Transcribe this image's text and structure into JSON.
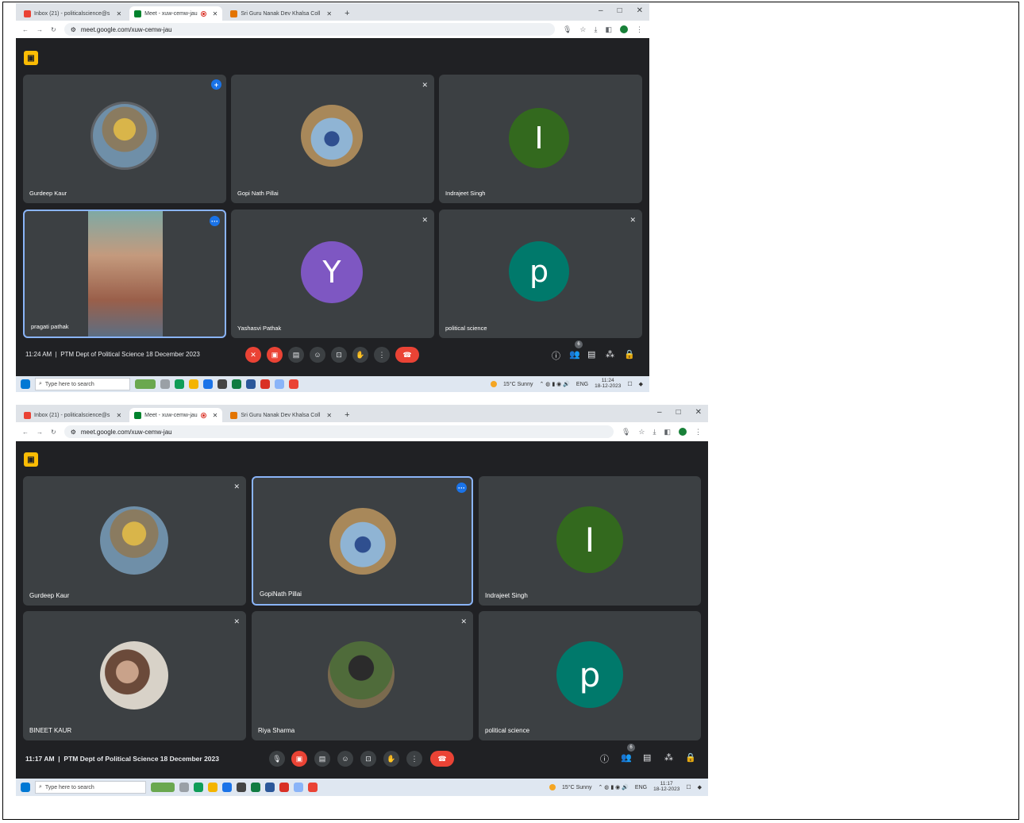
{
  "screens": [
    {
      "tabs": [
        {
          "label": "Inbox (21) - politicalscience@s",
          "favicon_color": "#ea4335"
        },
        {
          "label": "Meet - xuw-cemw-jau",
          "favicon_color": "#00832d"
        },
        {
          "label": "Sri Guru Nanak Dev Khalsa Coll",
          "favicon_color": "#e37400"
        }
      ],
      "url": "meet.google.com/xuw-cemw-jau",
      "participants": [
        {
          "name": "Gurdeep Kaur",
          "type": "photo",
          "badge": "+"
        },
        {
          "name": "Gopi Nath Pillai",
          "type": "photo",
          "muted": true
        },
        {
          "name": "Indrajeet Singh",
          "type": "initial",
          "initial": "I",
          "color": "#33691e"
        },
        {
          "name": "pragati pathak",
          "type": "video",
          "badge": "···"
        },
        {
          "name": "Yashasvi Pathak",
          "type": "initial",
          "initial": "Y",
          "color": "#7e57c2",
          "muted": true
        },
        {
          "name": "political science",
          "type": "initial",
          "initial": "p",
          "color": "#00796b",
          "muted": true
        }
      ],
      "time": "11:24 AM",
      "meeting_title": "PTM Dept of Political Science 18 December 2023",
      "people_count": "6",
      "taskbar": {
        "search_placeholder": "Type here to search",
        "weather": "15°C Sunny",
        "lang": "ENG",
        "clock_time": "11:24",
        "clock_date": "18-12-2023"
      }
    },
    {
      "tabs": [
        {
          "label": "Inbox (21) - politicalscience@s",
          "favicon_color": "#ea4335"
        },
        {
          "label": "Meet - xuw-cemw-jau",
          "favicon_color": "#00832d"
        },
        {
          "label": "Sri Guru Nanak Dev Khalsa Coll",
          "favicon_color": "#e37400"
        }
      ],
      "url": "meet.google.com/xuw-cemw-jau",
      "participants": [
        {
          "name": "Gurdeep Kaur",
          "type": "photo",
          "muted": true
        },
        {
          "name": "GopiNath Pillai",
          "type": "photo",
          "badge": "···",
          "active": true
        },
        {
          "name": "Indrajeet Singh",
          "type": "initial",
          "initial": "I",
          "color": "#33691e"
        },
        {
          "name": "BINEET KAUR",
          "type": "photo",
          "muted": true
        },
        {
          "name": "Riya Sharma",
          "type": "photo",
          "muted": true
        },
        {
          "name": "political science",
          "type": "initial",
          "initial": "p",
          "color": "#00796b"
        }
      ],
      "time": "11:17 AM",
      "meeting_title": "PTM Dept of Political Science 18 December 2023",
      "people_count": "6",
      "taskbar": {
        "search_placeholder": "Type here to search",
        "weather": "15°C Sunny",
        "lang": "ENG",
        "clock_time": "11:17",
        "clock_date": "18-12-2023"
      }
    }
  ],
  "separator": "|"
}
